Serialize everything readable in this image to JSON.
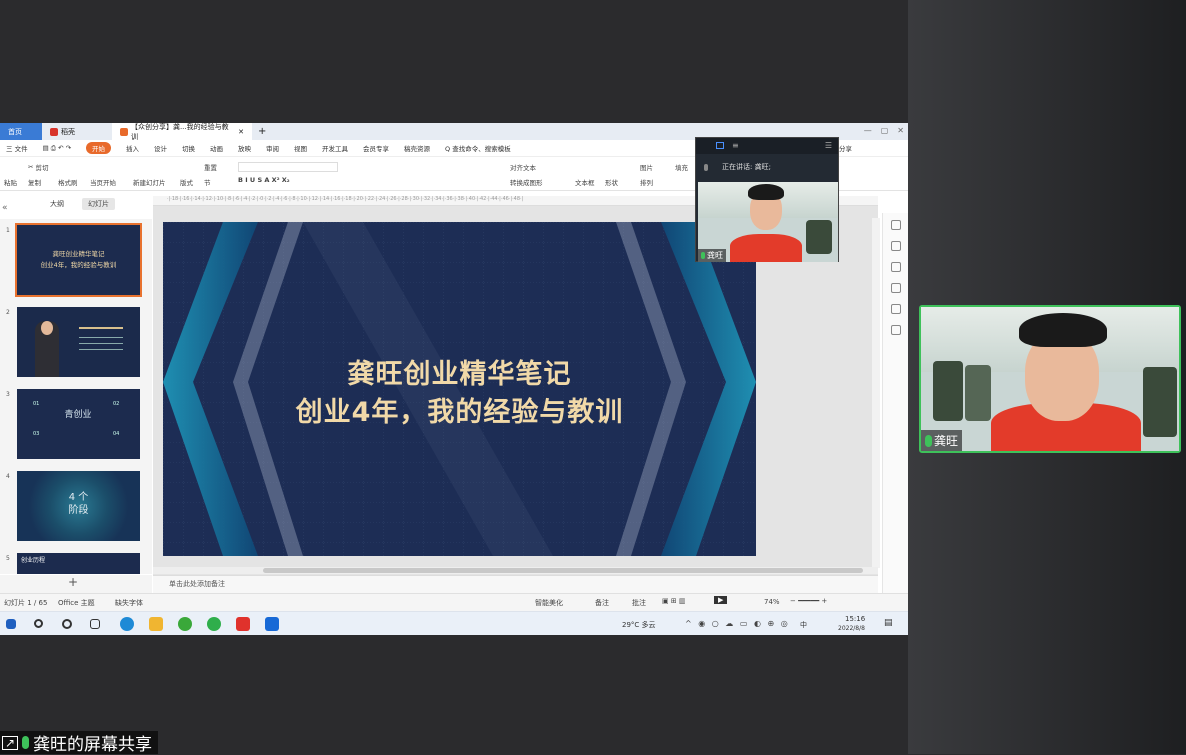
{
  "wps": {
    "tabs": {
      "home": "首页",
      "template": "稻壳",
      "doc": "【众创分享】龚...我的经验与教训"
    },
    "menu": [
      "三 文件",
      "开始",
      "插入",
      "设计",
      "切换",
      "动画",
      "放映",
      "审阅",
      "视图",
      "开发工具",
      "会员专享",
      "稿壳资源",
      "Q 查找命令、搜索模板",
      "分享"
    ],
    "ribbon": {
      "paste": "粘贴",
      "cut": "剪切",
      "copy": "复制",
      "format": "格式刷",
      "from_current": "当页开始",
      "new_slide": "新建幻灯片",
      "layout": "版式",
      "section": "节",
      "reset": "重置",
      "text_box": "文本框",
      "shapes": "形状",
      "arrange": "排列",
      "picture": "图片",
      "fill": "填充",
      "align_text": "对齐文本",
      "convert_smartart": "转换成图形"
    },
    "panel": {
      "outline": "大纲",
      "slides": "幻灯片"
    },
    "thumbs": [
      {
        "num": "1",
        "line1": "龚旺创业精华笔记",
        "line2": "创业4年，我的经验与教训"
      },
      {
        "num": "2"
      },
      {
        "num": "3",
        "center": "青创业",
        "items": [
          "01",
          "02",
          "03",
          "04"
        ]
      },
      {
        "num": "4",
        "line1": "4 个",
        "line2": "阶段"
      },
      {
        "num": "5",
        "line1": "创业历程"
      }
    ],
    "slide": {
      "title1": "龚旺创业精华笔记",
      "title2": "创业4年，我的经验与教训"
    },
    "notes": "单击此处添加备注",
    "status": {
      "slide_count": "幻灯片 1 / 65",
      "theme": "Office 主题",
      "font": "缺失字体",
      "smart": "智能美化",
      "notes_btn": "备注",
      "comment": "批注",
      "zoom": "74%"
    },
    "taskbar": {
      "weather": "29°C 多云",
      "time": "15:16",
      "date": "2022/8/8",
      "lang": "中"
    }
  },
  "mini_video": {
    "speaking": "正在讲话: 龚旺;",
    "name": "龚旺"
  },
  "big_video": {
    "name": "龚旺"
  },
  "share_label": "龚旺的屏幕共享",
  "colors": {
    "accent_green": "#3ec15a",
    "wps_orange": "#e86a2b",
    "slide_bg": "#1d2d55",
    "title_gold": "#f1d9a8"
  }
}
